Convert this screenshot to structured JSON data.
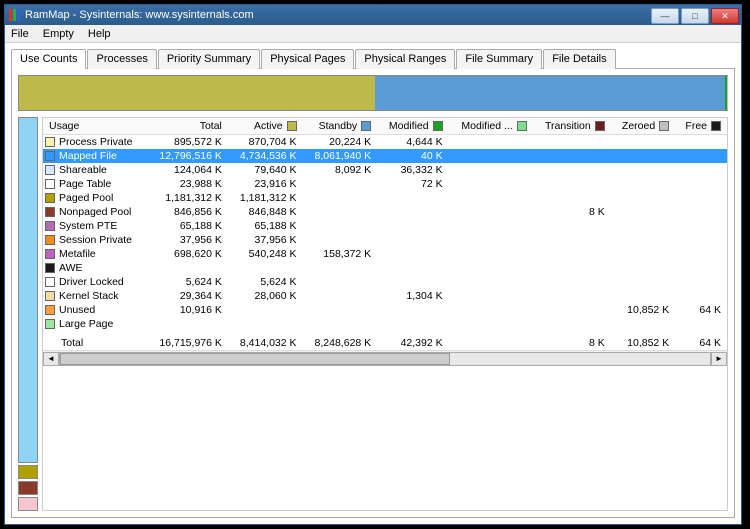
{
  "window": {
    "title": "RamMap - Sysinternals: www.sysinternals.com"
  },
  "menu": {
    "file": "File",
    "empty": "Empty",
    "help": "Help"
  },
  "tabs": {
    "use_counts": "Use Counts",
    "processes": "Processes",
    "priority_summary": "Priority Summary",
    "physical_pages": "Physical Pages",
    "physical_ranges": "Physical Ranges",
    "file_summary": "File Summary",
    "file_details": "File Details"
  },
  "columns": {
    "usage": "Usage",
    "total": "Total",
    "active": "Active",
    "standby": "Standby",
    "modified": "Modified",
    "modified_np": "Modified ...",
    "transition": "Transition",
    "zeroed": "Zeroed",
    "free": "Free"
  },
  "col_colors": {
    "active": "#bdb94a",
    "standby": "#5a9bd5",
    "modified": "#19a221",
    "modified_np": "#7ee08a",
    "transition": "#6b1f1f",
    "zeroed": "#bfbfbf",
    "free": "#1a1a1a"
  },
  "rows": [
    {
      "sw": "#fff3b0",
      "name": "Process Private",
      "total": "895,572 K",
      "active": "870,704 K",
      "standby": "20,224 K",
      "modified": "4,644 K",
      "modified_np": "",
      "transition": "",
      "zeroed": "",
      "free": ""
    },
    {
      "sw": "#3399ff",
      "name": "Mapped File",
      "total": "12,796,516 K",
      "active": "4,734,536 K",
      "standby": "8,061,940 K",
      "modified": "40 K",
      "modified_np": "",
      "transition": "",
      "zeroed": "",
      "free": "",
      "selected": true
    },
    {
      "sw": "#d6e9ff",
      "name": "Shareable",
      "total": "124,064 K",
      "active": "79,640 K",
      "standby": "8,092 K",
      "modified": "36,332 K",
      "modified_np": "",
      "transition": "",
      "zeroed": "",
      "free": ""
    },
    {
      "sw": "#ffffff",
      "name": "Page Table",
      "total": "23,988 K",
      "active": "23,916 K",
      "standby": "",
      "modified": "72 K",
      "modified_np": "",
      "transition": "",
      "zeroed": "",
      "free": ""
    },
    {
      "sw": "#b0a000",
      "name": "Paged Pool",
      "total": "1,181,312 K",
      "active": "1,181,312 K",
      "standby": "",
      "modified": "",
      "modified_np": "",
      "transition": "",
      "zeroed": "",
      "free": ""
    },
    {
      "sw": "#8a3a2a",
      "name": "Nonpaged Pool",
      "total": "846,856 K",
      "active": "846,848 K",
      "standby": "",
      "modified": "",
      "modified_np": "",
      "transition": "8 K",
      "zeroed": "",
      "free": ""
    },
    {
      "sw": "#b56bb5",
      "name": "System PTE",
      "total": "65,188 K",
      "active": "65,188 K",
      "standby": "",
      "modified": "",
      "modified_np": "",
      "transition": "",
      "zeroed": "",
      "free": ""
    },
    {
      "sw": "#f28c1e",
      "name": "Session Private",
      "total": "37,956 K",
      "active": "37,956 K",
      "standby": "",
      "modified": "",
      "modified_np": "",
      "transition": "",
      "zeroed": "",
      "free": ""
    },
    {
      "sw": "#c060c0",
      "name": "Metafile",
      "total": "698,620 K",
      "active": "540,248 K",
      "standby": "158,372 K",
      "modified": "",
      "modified_np": "",
      "transition": "",
      "zeroed": "",
      "free": ""
    },
    {
      "sw": "#1a1a1a",
      "name": "AWE",
      "total": "",
      "active": "",
      "standby": "",
      "modified": "",
      "modified_np": "",
      "transition": "",
      "zeroed": "",
      "free": ""
    },
    {
      "sw": "#ffffff",
      "name": "Driver Locked",
      "total": "5,624 K",
      "active": "5,624 K",
      "standby": "",
      "modified": "",
      "modified_np": "",
      "transition": "",
      "zeroed": "",
      "free": ""
    },
    {
      "sw": "#f5dca0",
      "name": "Kernel Stack",
      "total": "29,364 K",
      "active": "28,060 K",
      "standby": "",
      "modified": "1,304 K",
      "modified_np": "",
      "transition": "",
      "zeroed": "",
      "free": ""
    },
    {
      "sw": "#ff9e3d",
      "name": "Unused",
      "total": "10,916 K",
      "active": "",
      "standby": "",
      "modified": "",
      "modified_np": "",
      "transition": "",
      "zeroed": "10,852 K",
      "free": "64 K"
    },
    {
      "sw": "#9be8a0",
      "name": "Large Page",
      "total": "",
      "active": "",
      "standby": "",
      "modified": "",
      "modified_np": "",
      "transition": "",
      "zeroed": "",
      "free": ""
    }
  ],
  "total_row": {
    "name": "Total",
    "total": "16,715,976 K",
    "active": "8,414,032 K",
    "standby": "8,248,628 K",
    "modified": "42,392 K",
    "modified_np": "",
    "transition": "8 K",
    "zeroed": "10,852 K",
    "free": "64 K"
  },
  "chart_data": {
    "type": "bar",
    "orientation": "horizontal-stacked",
    "title": "Memory Use Counts",
    "unit": "K",
    "segments": [
      {
        "name": "Active",
        "value": 8414032,
        "color": "#bdb94a"
      },
      {
        "name": "Standby",
        "value": 8248628,
        "color": "#5a9bd5"
      },
      {
        "name": "Modified",
        "value": 42392,
        "color": "#19a221"
      },
      {
        "name": "Transition",
        "value": 8,
        "color": "#6b1f1f"
      },
      {
        "name": "Zeroed",
        "value": 10852,
        "color": "#bfbfbf"
      },
      {
        "name": "Free",
        "value": 64,
        "color": "#1a1a1a"
      }
    ],
    "total": 16715976
  },
  "sidebar_swatches": [
    {
      "color": "#b0a000"
    },
    {
      "color": "#8a3a2a"
    },
    {
      "color": "#f7c6d0"
    }
  ]
}
